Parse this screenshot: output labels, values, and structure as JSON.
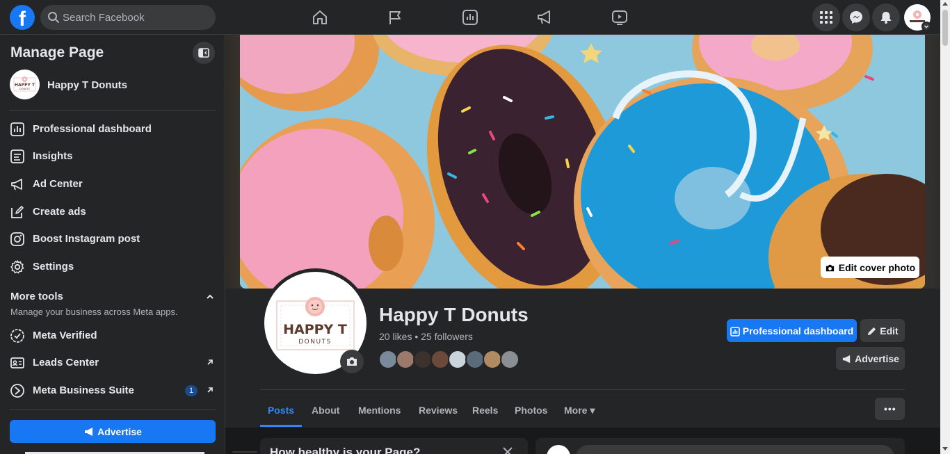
{
  "header": {
    "logo_letter": "f",
    "search_placeholder": "Search Facebook"
  },
  "sidebar": {
    "title": "Manage Page",
    "page_name": "Happy T Donuts",
    "items": [
      {
        "label": "Professional dashboard",
        "icon": "dashboard-icon"
      },
      {
        "label": "Insights",
        "icon": "insights-icon"
      },
      {
        "label": "Ad Center",
        "icon": "megaphone-icon"
      },
      {
        "label": "Create ads",
        "icon": "pencil-icon"
      },
      {
        "label": "Boost Instagram post",
        "icon": "instagram-icon"
      },
      {
        "label": "Settings",
        "icon": "gear-icon"
      }
    ],
    "more_tools": {
      "title": "More tools",
      "subtitle": "Manage your business across Meta apps."
    },
    "tools": [
      {
        "label": "Meta Verified",
        "icon": "verified-badge-icon"
      },
      {
        "label": "Leads Center",
        "icon": "leads-icon"
      },
      {
        "label": "Meta Business Suite",
        "icon": "business-suite-icon",
        "count": "1"
      }
    ],
    "advertise_label": "Advertise"
  },
  "profile": {
    "name": "Happy T Donuts",
    "stats": "20 likes • 25 followers",
    "logo_text_top": "HAPPY T",
    "logo_text_bottom": "DONUTS",
    "edit_cover_label": "Edit cover photo",
    "professional_dashboard_label": "Professional dashboard",
    "edit_label": "Edit",
    "advertise_label": "Advertise"
  },
  "tabs": [
    {
      "label": "Posts",
      "active": true
    },
    {
      "label": "About",
      "active": false
    },
    {
      "label": "Mentions",
      "active": false
    },
    {
      "label": "Reviews",
      "active": false
    },
    {
      "label": "Reels",
      "active": false
    },
    {
      "label": "Photos",
      "active": false
    },
    {
      "label": "More ▾",
      "active": false
    }
  ],
  "tab_overflow_label": "•••",
  "page_health": {
    "title": "How healthy is your Page?"
  },
  "colors": {
    "accent": "#1877f2",
    "link_active": "#2d88ff",
    "background": "#18191a",
    "surface": "#242526"
  }
}
